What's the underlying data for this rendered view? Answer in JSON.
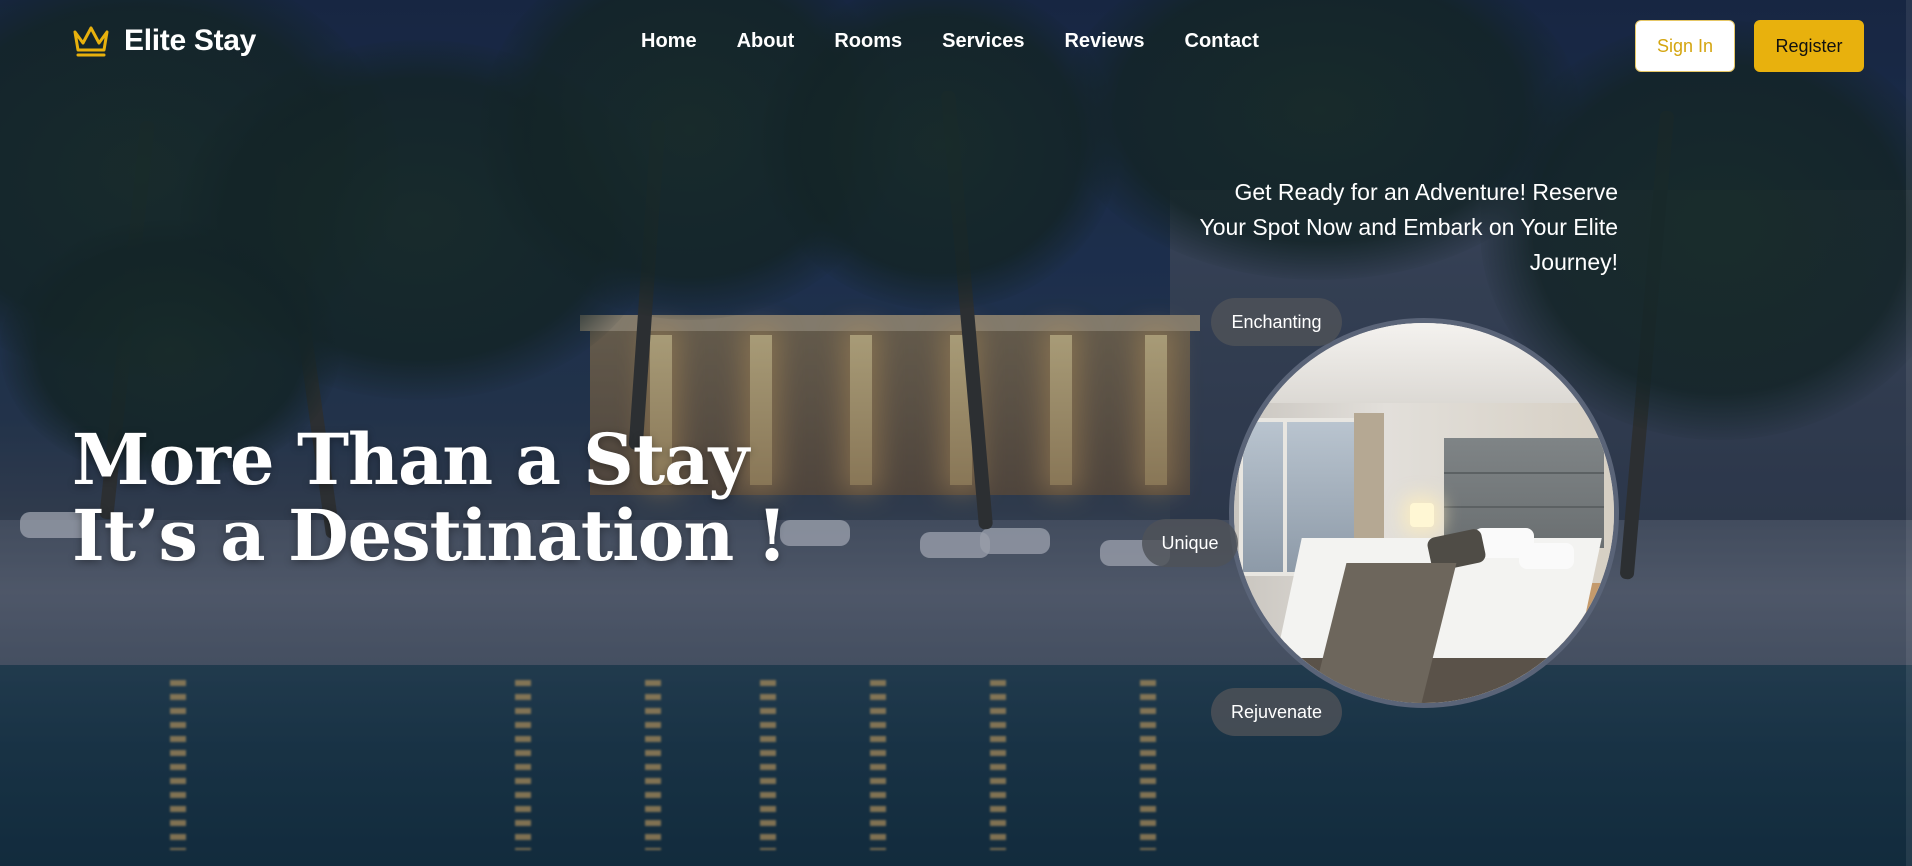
{
  "brand": {
    "name": "Elite Stay",
    "logo_icon": "crown-icon",
    "accent": "#E8B10D"
  },
  "nav": {
    "items": [
      {
        "label": "Home"
      },
      {
        "label": "About"
      },
      {
        "label": "Rooms"
      },
      {
        "label": "Services"
      },
      {
        "label": "Reviews"
      },
      {
        "label": "Contact"
      }
    ],
    "sign_in_label": "Sign In",
    "register_label": "Register"
  },
  "hero": {
    "title_line1": "More Than a Stay",
    "title_line2": "It’s a Destination !",
    "tagline": "Get Ready for an Adventure! Reserve Your Spot Now and Embark on Your Elite Journey!",
    "badges": [
      "Enchanting",
      "Unique",
      "Rejuvenate"
    ]
  }
}
